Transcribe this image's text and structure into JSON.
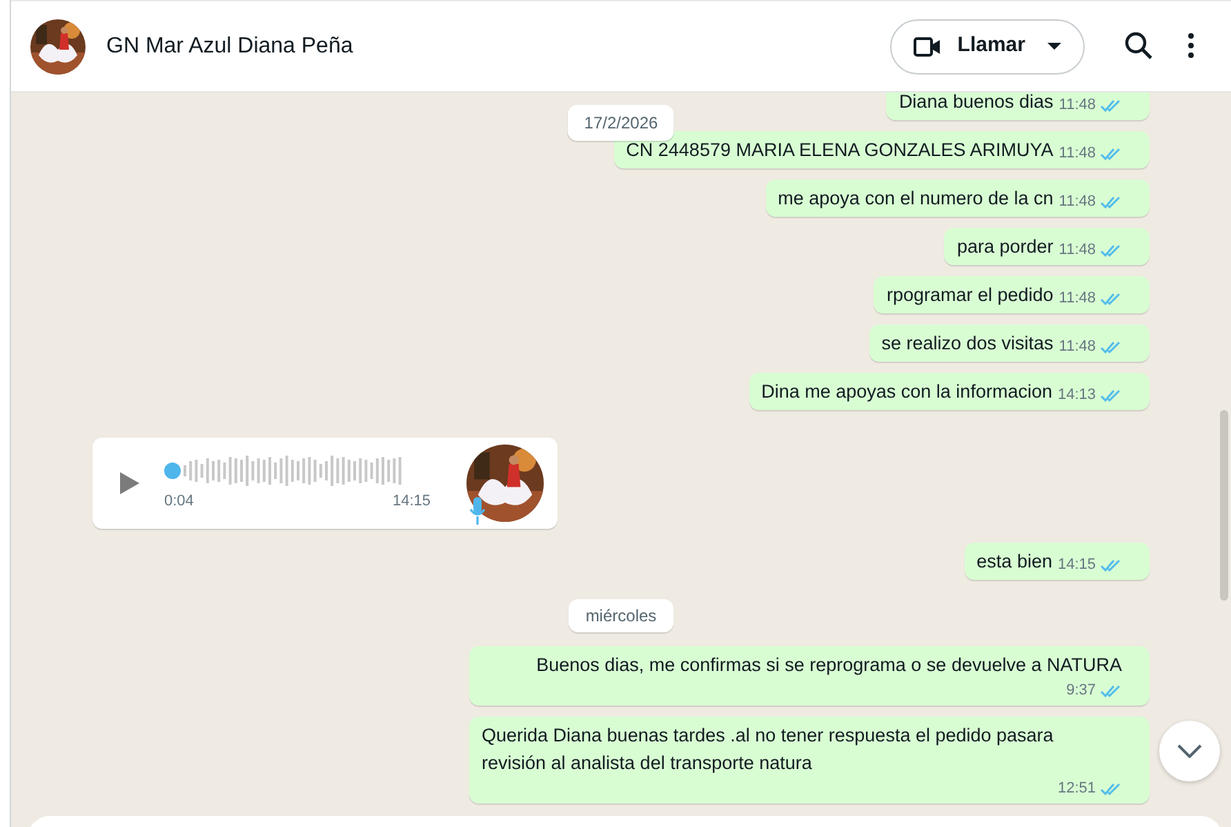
{
  "header": {
    "title": "GN Mar Azul Diana Peña",
    "call_button": {
      "label": "Llamar"
    }
  },
  "floating_date": {
    "label": "17/2/2026"
  },
  "messages": [
    {
      "kind": "out",
      "text": "Diana buenos dias",
      "time": "11:48",
      "read": true
    },
    {
      "kind": "out",
      "text": "CN 2448579 MARIA ELENA GONZALES  ARIMUYA",
      "time": "11:48",
      "read": true
    },
    {
      "kind": "out",
      "text": "me apoya con el numero de la cn",
      "time": "11:48",
      "read": true
    },
    {
      "kind": "out",
      "text": "para porder",
      "time": "11:48",
      "read": true
    },
    {
      "kind": "out",
      "text": "rpogramar el pedido",
      "time": "11:48",
      "read": true
    },
    {
      "kind": "out",
      "text": "se realizo dos visitas",
      "time": "11:48",
      "read": true
    },
    {
      "kind": "out",
      "text": "Dina me apoyas con la informacion",
      "time": "14:13",
      "read": true
    },
    {
      "kind": "voice",
      "duration": "0:04",
      "time": "14:15"
    },
    {
      "kind": "out",
      "text": "esta bien",
      "time": "14:15",
      "read": true
    },
    {
      "kind": "date",
      "text": "miércoles"
    },
    {
      "kind": "out",
      "text": "Buenos dias, me confirmas si se reprograma o se devuelve a NATURA",
      "time": "9:37",
      "read": true
    },
    {
      "kind": "out",
      "text": "Querida Diana buenas tardes .al no tener respuesta  el pedido pasara revisión al analista del transporte natura",
      "time": "12:51",
      "read": true
    }
  ]
}
